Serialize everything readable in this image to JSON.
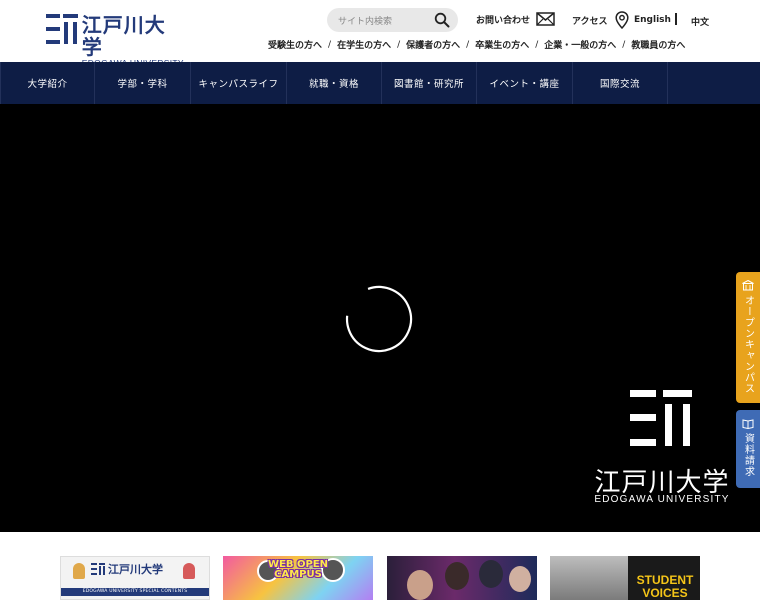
{
  "header": {
    "logo_jp": "江戸川大学",
    "logo_en": "EDOGAWA UNIVERSITY",
    "search_placeholder": "サイト内検索",
    "contact_label": "お問い合わせ",
    "access_label": "アクセス",
    "lang_english": "English",
    "lang_chinese": "中文",
    "audience_links": [
      "受験生の方へ",
      "在学生の方へ",
      "保護者の方へ",
      "卒業生の方へ",
      "企業・一般の方へ",
      "教職員の方へ"
    ],
    "audience_separator": "/",
    "brand_color": "#233a7a"
  },
  "nav": {
    "items": [
      "大学紹介",
      "学部・学科",
      "キャンパスライフ",
      "就職・資格",
      "図書館・研究所",
      "イベント・講座",
      "国際交流"
    ],
    "background_color": "#0e1d45"
  },
  "hero": {
    "logo_jp": "江戸川大学",
    "logo_en": "EDOGAWA UNIVERSITY",
    "state": "loading"
  },
  "side_tabs": {
    "open_campus": "オープンキャンパス",
    "open_campus_color": "#e8a31d",
    "request_docs": "資料請求",
    "request_docs_color": "#3f6bb5"
  },
  "banners": {
    "special_logo": "江戸川大学",
    "special_strip": "EDOGAWA UNIVERSITY SPECIAL CONTENTS",
    "web_open_campus": "WEB OPEN CAMPUS",
    "student_voices": "STUDENT VOICES"
  }
}
